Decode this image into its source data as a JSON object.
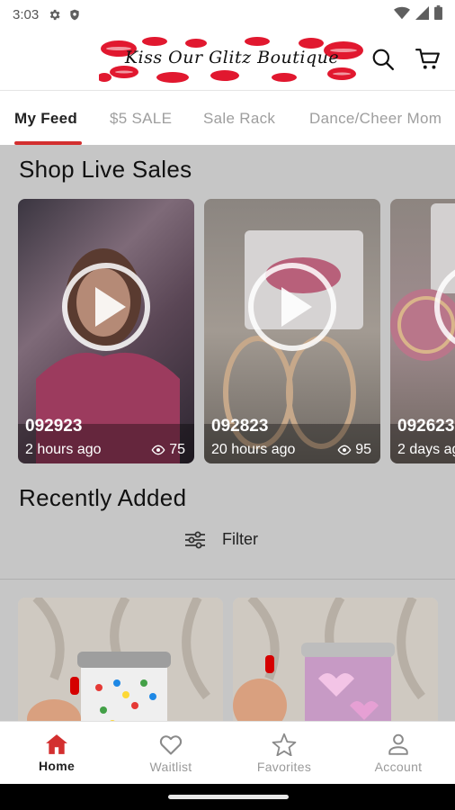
{
  "status_bar": {
    "time": "3:03"
  },
  "header": {
    "logo_text": "Kiss Our Glitz Boutique",
    "colors": {
      "lips": "#e1182f"
    }
  },
  "tabs": [
    {
      "label": "My Feed",
      "active": true
    },
    {
      "label": "$5 SALE",
      "active": false
    },
    {
      "label": "Sale Rack",
      "active": false
    },
    {
      "label": "Dance/Cheer Mom",
      "active": false
    }
  ],
  "live_sales": {
    "title": "Shop Live Sales",
    "cards": [
      {
        "code": "092923",
        "ago": "2 hours ago",
        "views": "75"
      },
      {
        "code": "092823",
        "ago": "20 hours ago",
        "views": "95"
      },
      {
        "code": "092623",
        "ago": "2 days ago",
        "views": ""
      }
    ]
  },
  "recently_added": {
    "title": "Recently Added",
    "filter_label": "Filter"
  },
  "bottom_nav": [
    {
      "label": "Home",
      "icon": "home-icon",
      "active": true
    },
    {
      "label": "Waitlist",
      "icon": "heart-icon",
      "active": false
    },
    {
      "label": "Favorites",
      "icon": "star-icon",
      "active": false
    },
    {
      "label": "Account",
      "icon": "person-icon",
      "active": false
    }
  ],
  "colors": {
    "accent": "#d32f2f",
    "overlay": "#c6c6c6"
  }
}
